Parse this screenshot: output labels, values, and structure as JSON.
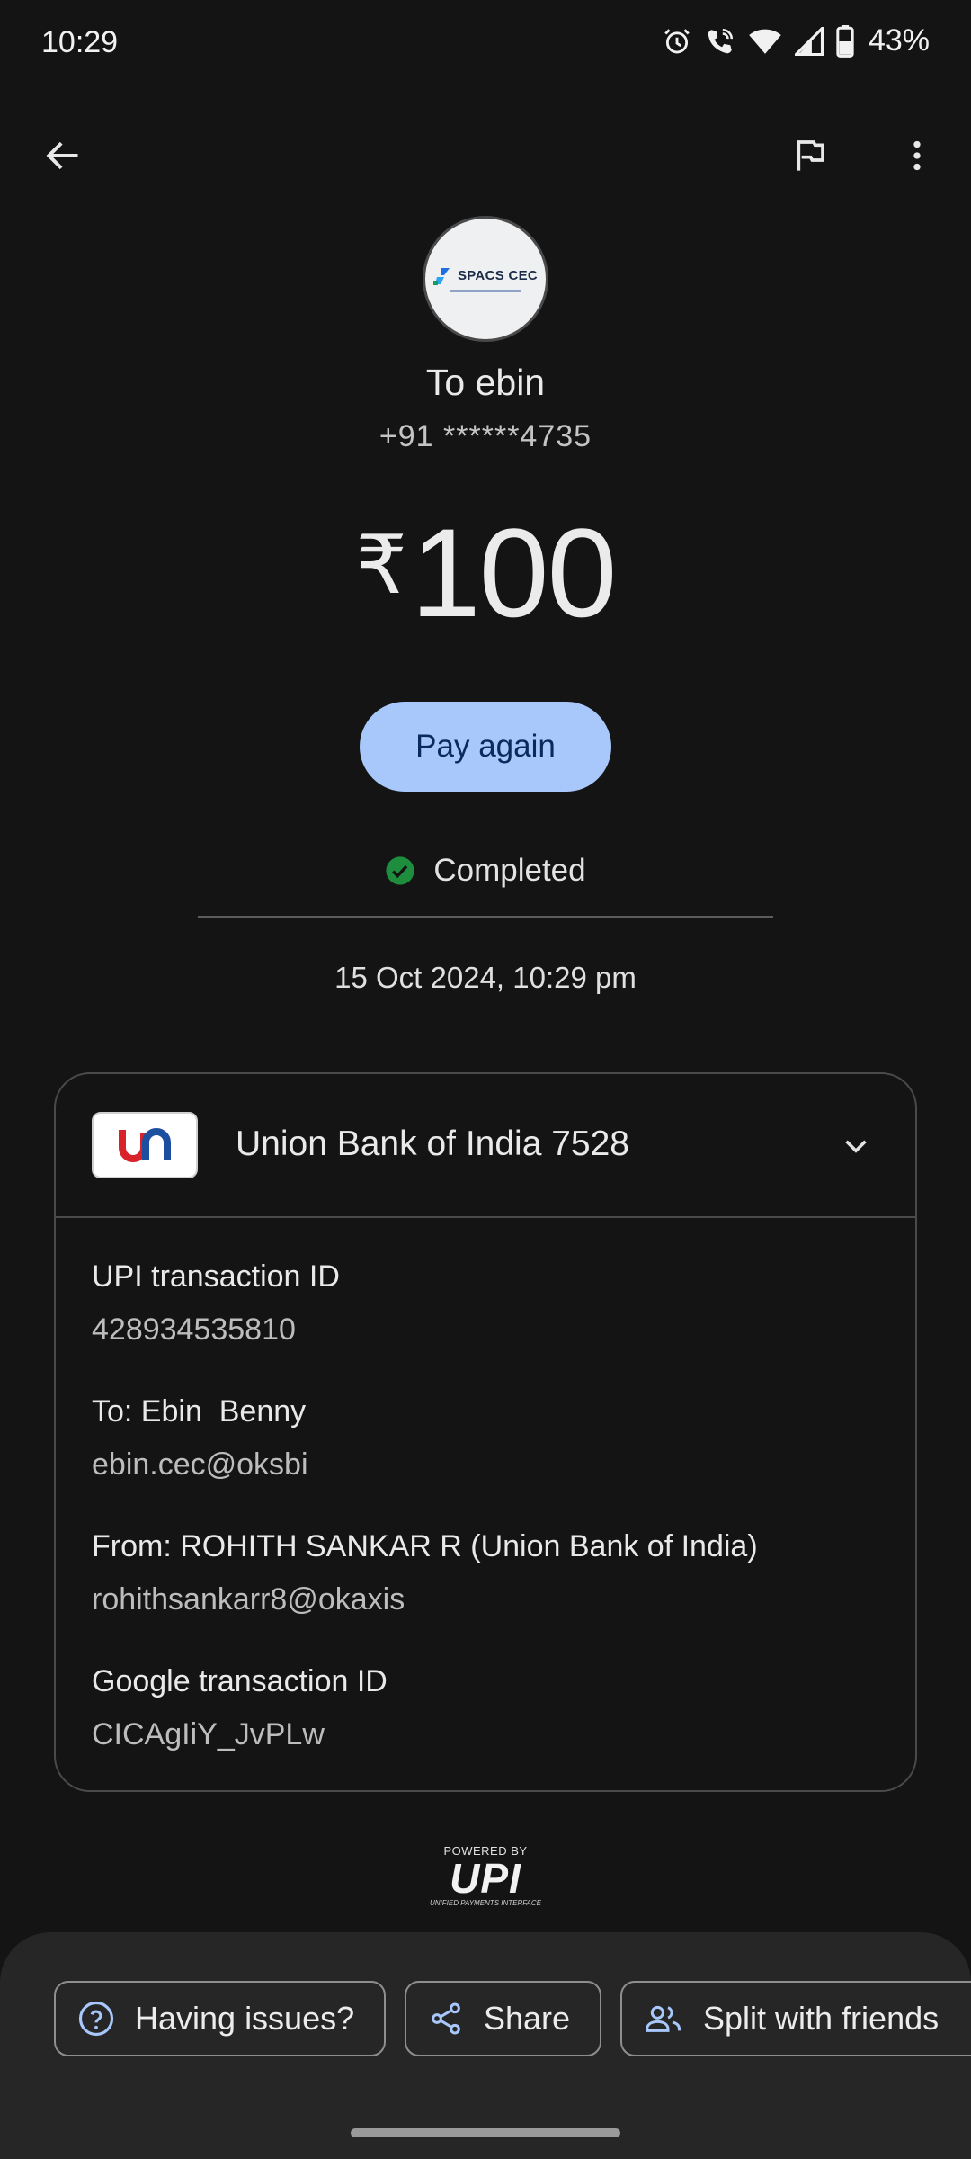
{
  "status_bar": {
    "time": "10:29",
    "battery": "43%",
    "icons": [
      "alarm-icon",
      "wifi-calling-icon",
      "wifi-icon",
      "signal-icon",
      "battery-icon"
    ]
  },
  "app_bar": {
    "icons": [
      "back-arrow-icon",
      "flag-icon",
      "more-vert-icon"
    ]
  },
  "header": {
    "avatar_text": "SPACS CEC",
    "to_name": "To ebin",
    "phone": "+91 ******4735",
    "currency": "₹",
    "amount": "100",
    "pay_again_label": "Pay again",
    "status": "Completed",
    "datetime": "15 Oct 2024, 10:29 pm"
  },
  "details": {
    "bank_name": "Union Bank of India 7528",
    "items": [
      {
        "label": "UPI transaction ID",
        "value": "428934535810"
      },
      {
        "label": "To: Ebin  Benny",
        "value": "ebin.cec@oksbi"
      },
      {
        "label": "From: ROHITH SANKAR R (Union Bank of India)",
        "value": "rohithsankarr8@okaxis"
      },
      {
        "label": "Google transaction ID",
        "value": "CICAgIiY_JvPLw"
      }
    ]
  },
  "footer": {
    "powered_by": "POWERED BY",
    "upi_logo": "UPI",
    "upi_sub": "UNIFIED PAYMENTS INTERFACE"
  },
  "actions": {
    "issues_label": "Having issues?",
    "share_label": "Share",
    "split_label": "Split with friends"
  },
  "colors": {
    "background": "#141414",
    "accent": "#a8c7fa",
    "success": "#1e8e3e"
  }
}
